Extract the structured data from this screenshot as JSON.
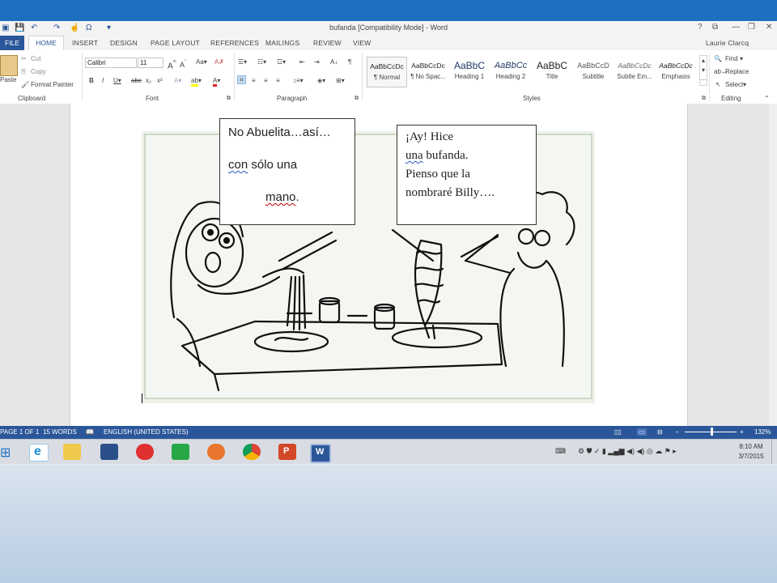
{
  "window": {
    "title": "bufanda [Compatibility Mode] - Word",
    "user": "Laurie Clarcq",
    "controls": [
      "?",
      "⧉",
      "—",
      "❐",
      "✕"
    ]
  },
  "tabs": [
    "FILE",
    "HOME",
    "INSERT",
    "DESIGN",
    "PAGE LAYOUT",
    "REFERENCES",
    "MAILINGS",
    "REVIEW",
    "VIEW"
  ],
  "clipboard": {
    "paste": "Paste",
    "cut": "Cut",
    "copy": "Copy",
    "format_painter": "Format Painter",
    "label": "Clipboard"
  },
  "font": {
    "name": "Calibri",
    "size": "11",
    "label": "Font"
  },
  "paragraph": {
    "label": "Paragraph"
  },
  "styles": {
    "label": "Styles",
    "items": [
      {
        "preview": "AaBbCcDc",
        "name": "¶ Normal"
      },
      {
        "preview": "AaBbCcDc",
        "name": "¶ No Spac..."
      },
      {
        "preview": "AaBbC",
        "name": "Heading 1"
      },
      {
        "preview": "AaBbCc",
        "name": "Heading 2"
      },
      {
        "preview": "AaBbC",
        "name": "Title"
      },
      {
        "preview": "AaBbCcD",
        "name": "Subtitle"
      },
      {
        "preview": "AaBbCcDc",
        "name": "Subtle Em..."
      },
      {
        "preview": "AaBbCcDc",
        "name": "Emphasis"
      }
    ]
  },
  "editing": {
    "find": "Find",
    "replace": "Replace",
    "select": "Select",
    "label": "Editing"
  },
  "document": {
    "bubble_left": {
      "line1": "No Abuelita…así…",
      "line2a": "con",
      "line2b": " sólo una",
      "line3": "mano",
      "line3_end": "."
    },
    "bubble_right": {
      "line1": "¡Ay!  Hice",
      "line2a": "una",
      "line2b": " bufanda.",
      "line3": "Pienso que la",
      "line4": "nombraré Billy…."
    }
  },
  "status": {
    "page": "PAGE 1 OF 1",
    "words": "15 WORDS",
    "language": "ENGLISH (UNITED STATES)",
    "zoom": "132%"
  },
  "taskbar": {
    "time": "8:10 AM",
    "date": "3/7/2015",
    "apps": [
      "ie-icon",
      "file-explorer-icon",
      "monitor-icon",
      "cloud-icon",
      "store-icon",
      "firefox-icon",
      "chrome-icon",
      "powerpoint-icon",
      "word-icon"
    ]
  },
  "colors": {
    "word_blue": "#2b579a",
    "top_bar": "#1e6fc2",
    "spell_error": "#c00000"
  }
}
